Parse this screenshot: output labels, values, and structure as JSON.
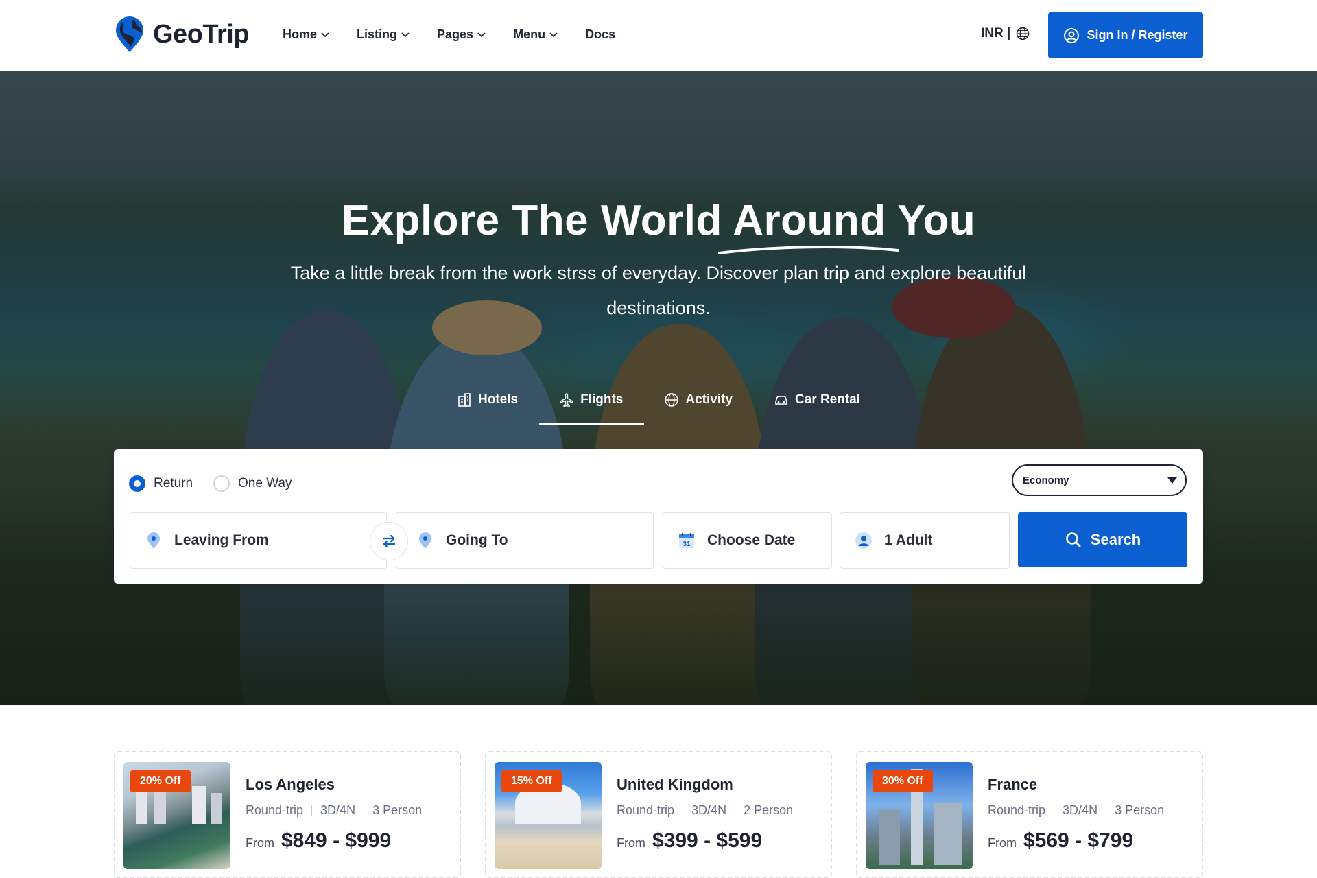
{
  "brand": {
    "name": "GeoTrip",
    "primary_color": "#0b5fd0",
    "accent_color": "#e8470e"
  },
  "nav": {
    "items": [
      {
        "label": "Home",
        "dropdown": true
      },
      {
        "label": "Listing",
        "dropdown": true
      },
      {
        "label": "Pages",
        "dropdown": true
      },
      {
        "label": "Menu",
        "dropdown": true
      },
      {
        "label": "Docs",
        "dropdown": false
      }
    ],
    "currency": "INR |",
    "signin_label": "Sign In / Register"
  },
  "hero": {
    "title": "Explore The World Around You",
    "subtitle": "Take a little break from the work strss of everyday. Discover plan trip and explore beautiful destinations.",
    "tabs": [
      {
        "label": "Hotels",
        "icon": "hotel-icon"
      },
      {
        "label": "Flights",
        "icon": "plane-icon",
        "active": true
      },
      {
        "label": "Activity",
        "icon": "globe-icon"
      },
      {
        "label": "Car Rental",
        "icon": "car-icon"
      }
    ]
  },
  "search": {
    "trip_types": [
      {
        "label": "Return",
        "selected": true
      },
      {
        "label": "One Way",
        "selected": false
      }
    ],
    "cabin_class": "Economy",
    "leaving_from": "Leaving From",
    "going_to": "Going To",
    "date": "Choose Date",
    "calendar_day": "31",
    "travellers": "1 Adult",
    "button_label": "Search"
  },
  "deals": [
    {
      "badge": "20% Off",
      "title": "Los Angeles",
      "trip": "Round-trip",
      "duration": "3D/4N",
      "persons": "3 Person",
      "from_label": "From",
      "price": "$849 - $999"
    },
    {
      "badge": "15% Off",
      "title": "United Kingdom",
      "trip": "Round-trip",
      "duration": "3D/4N",
      "persons": "2 Person",
      "from_label": "From",
      "price": "$399 - $599"
    },
    {
      "badge": "30% Off",
      "title": "France",
      "trip": "Round-trip",
      "duration": "3D/4N",
      "persons": "3 Person",
      "from_label": "From",
      "price": "$569 - $799"
    }
  ]
}
